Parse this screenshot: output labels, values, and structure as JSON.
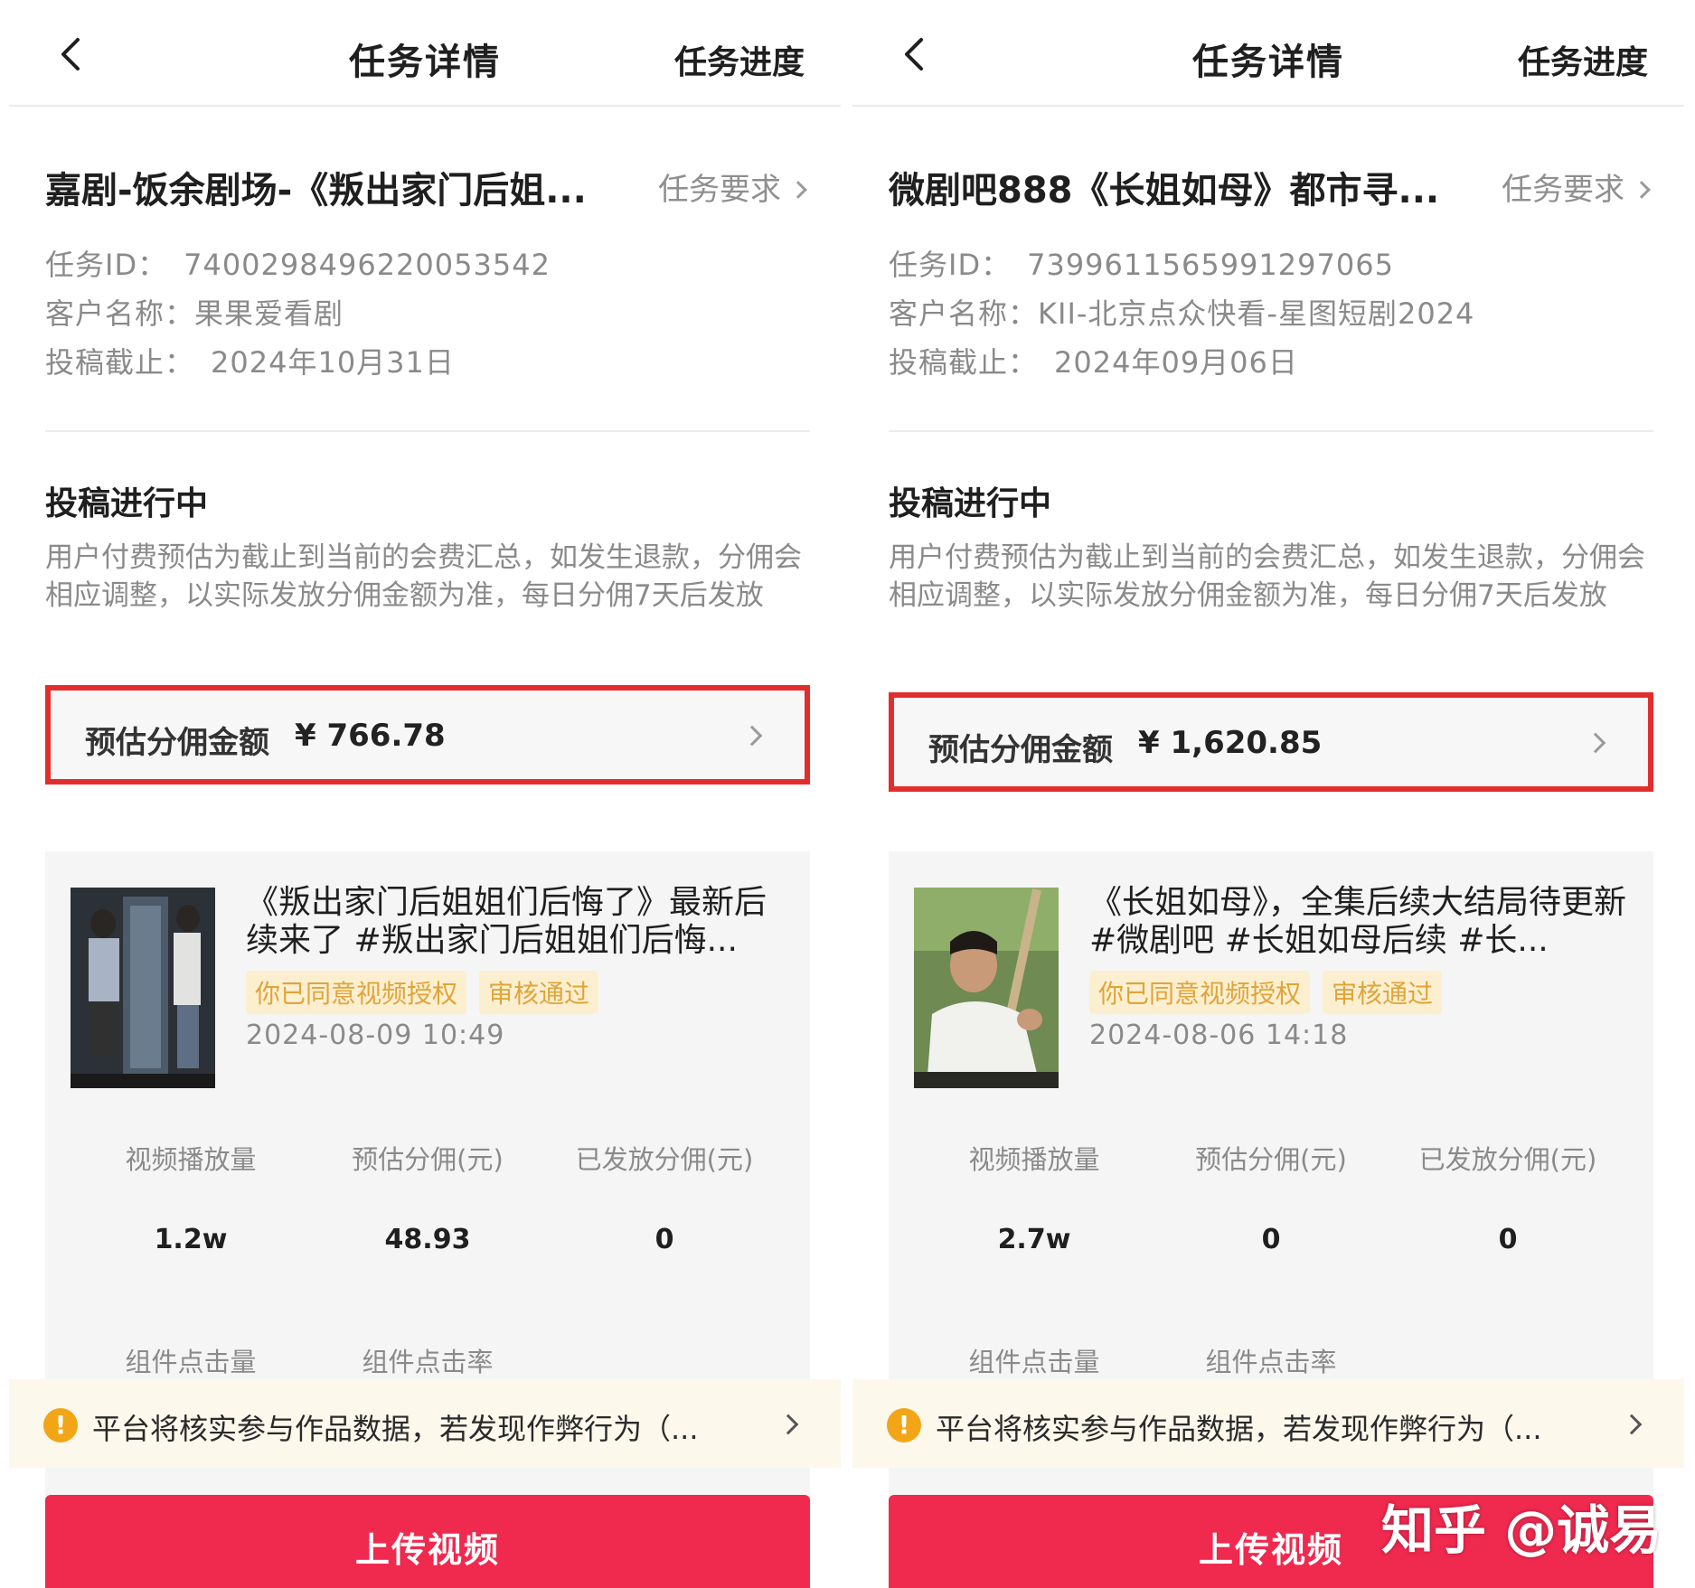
{
  "panels": [
    {
      "header": {
        "title": "任务详情",
        "right_action": "任务进度"
      },
      "task": {
        "title": "嘉剧-饭余剧场-《叛出家门后姐...",
        "requirements_link": "任务要求",
        "id_label": "任务ID：",
        "id_value": "7400298496220053542",
        "client_label": "客户名称：",
        "client_value": "果果爱看剧",
        "deadline_label": "投稿截止：",
        "deadline_value": "2024年10月31日"
      },
      "status": {
        "title": "投稿进行中",
        "description": "用户付费预估为截止到当前的会费汇总，如发生退款，分佣会相应调整，以实际发放分佣金额为准，每日分佣7天后发放"
      },
      "commission": {
        "label": "预估分佣金额",
        "amount": "¥ 766.78"
      },
      "video": {
        "title": "《叛出家门后姐姐们后悔了》最新后续来了 #叛出家门后姐姐们后悔...",
        "tags": [
          "你已同意视频授权",
          "审核通过"
        ],
        "date": "2024-08-09 10:49",
        "stats": [
          {
            "label": "视频播放量",
            "value": "1.2w"
          },
          {
            "label": "预估分佣(元)",
            "value": "48.93"
          },
          {
            "label": "已发放分佣(元)",
            "value": "0"
          }
        ],
        "stats2": [
          {
            "label": "组件点击量"
          },
          {
            "label": "组件点击率"
          }
        ]
      },
      "notice": "平台将核实参与作品数据，若发现作弊行为（...",
      "upload_label": "上传视频"
    },
    {
      "header": {
        "title": "任务详情",
        "right_action": "任务进度"
      },
      "task": {
        "title": "微剧吧888《长姐如母》都市寻...",
        "requirements_link": "任务要求",
        "id_label": "任务ID：",
        "id_value": "7399611565991297065",
        "client_label": "客户名称：",
        "client_value": "KII-北京点众快看-星图短剧2024",
        "deadline_label": "投稿截止：",
        "deadline_value": "2024年09月06日"
      },
      "status": {
        "title": "投稿进行中",
        "description": "用户付费预估为截止到当前的会费汇总，如发生退款，分佣会相应调整，以实际发放分佣金额为准，每日分佣7天后发放"
      },
      "commission": {
        "label": "预估分佣金额",
        "amount": "¥ 1,620.85"
      },
      "video": {
        "title": "《长姐如母》，全集后续大结局待更新 #微剧吧 #长姐如母后续 #长...",
        "tags": [
          "你已同意视频授权",
          "审核通过"
        ],
        "date": "2024-08-06 14:18",
        "stats": [
          {
            "label": "视频播放量",
            "value": "2.7w"
          },
          {
            "label": "预估分佣(元)",
            "value": "0"
          },
          {
            "label": "已发放分佣(元)",
            "value": "0"
          }
        ],
        "stats2": [
          {
            "label": "组件点击量"
          },
          {
            "label": "组件点击率"
          }
        ]
      },
      "notice": "平台将核实参与作品数据，若发现作弊行为（...",
      "upload_label": "上传视频"
    }
  ],
  "watermark": "知乎 @诚易",
  "colors": {
    "highlight_border": "#e22d2d",
    "upload_button": "#f0294f",
    "tag_bg": "#fcefcf",
    "tag_text": "#e0a43a",
    "warn_icon": "#f2a516"
  }
}
